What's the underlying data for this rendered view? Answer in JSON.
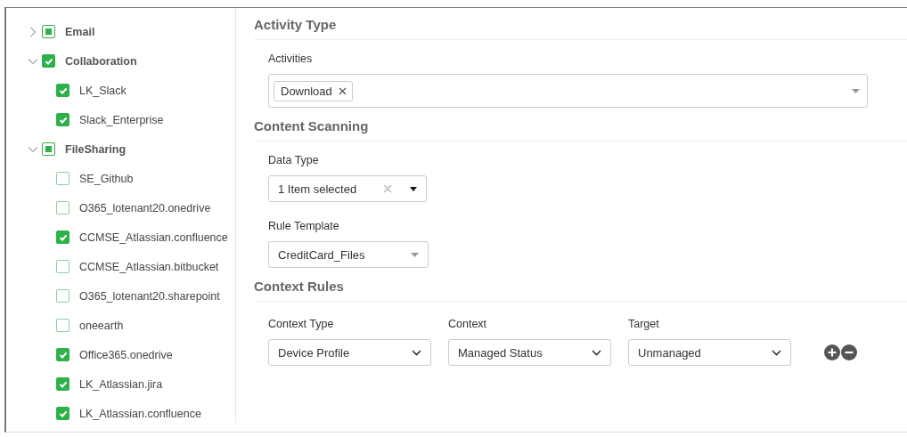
{
  "tree": [
    {
      "label": "Email",
      "expanded": false,
      "checked": false,
      "indeterminate": true
    },
    {
      "label": "Collaboration",
      "expanded": true,
      "checked": true,
      "children": [
        {
          "label": "LK_Slack",
          "checked": true
        },
        {
          "label": "Slack_Enterprise",
          "checked": true
        }
      ]
    },
    {
      "label": "FileSharing",
      "expanded": true,
      "checked": false,
      "indeterminate": true,
      "children": [
        {
          "label": "SE_Github",
          "checked": false
        },
        {
          "label": "O365_lotenant20.onedrive",
          "checked": false
        },
        {
          "label": "CCMSE_Atlassian.confluence",
          "checked": true
        },
        {
          "label": "CCMSE_Atlassian.bitbucket",
          "checked": false
        },
        {
          "label": "O365_lotenant20.sharepoint",
          "checked": false
        },
        {
          "label": "oneearth",
          "checked": false
        },
        {
          "label": "Office365.onedrive",
          "checked": true
        },
        {
          "label": "LK_Atlassian.jira",
          "checked": true
        },
        {
          "label": "LK_Atlassian.confluence",
          "checked": true
        }
      ]
    }
  ],
  "activity_type": {
    "title": "Activity Type",
    "activities_label": "Activities",
    "tags": [
      "Download"
    ]
  },
  "content_scanning": {
    "title": "Content Scanning",
    "data_type_label": "Data Type",
    "data_type_value": "1 Item selected",
    "rule_template_label": "Rule Template",
    "rule_template_value": "CreditCard_Files"
  },
  "context_rules": {
    "title": "Context Rules",
    "fields": [
      {
        "label": "Context Type",
        "value": "Device Profile"
      },
      {
        "label": "Context",
        "value": "Managed Status"
      },
      {
        "label": "Target",
        "value": "Unmanaged"
      }
    ]
  }
}
